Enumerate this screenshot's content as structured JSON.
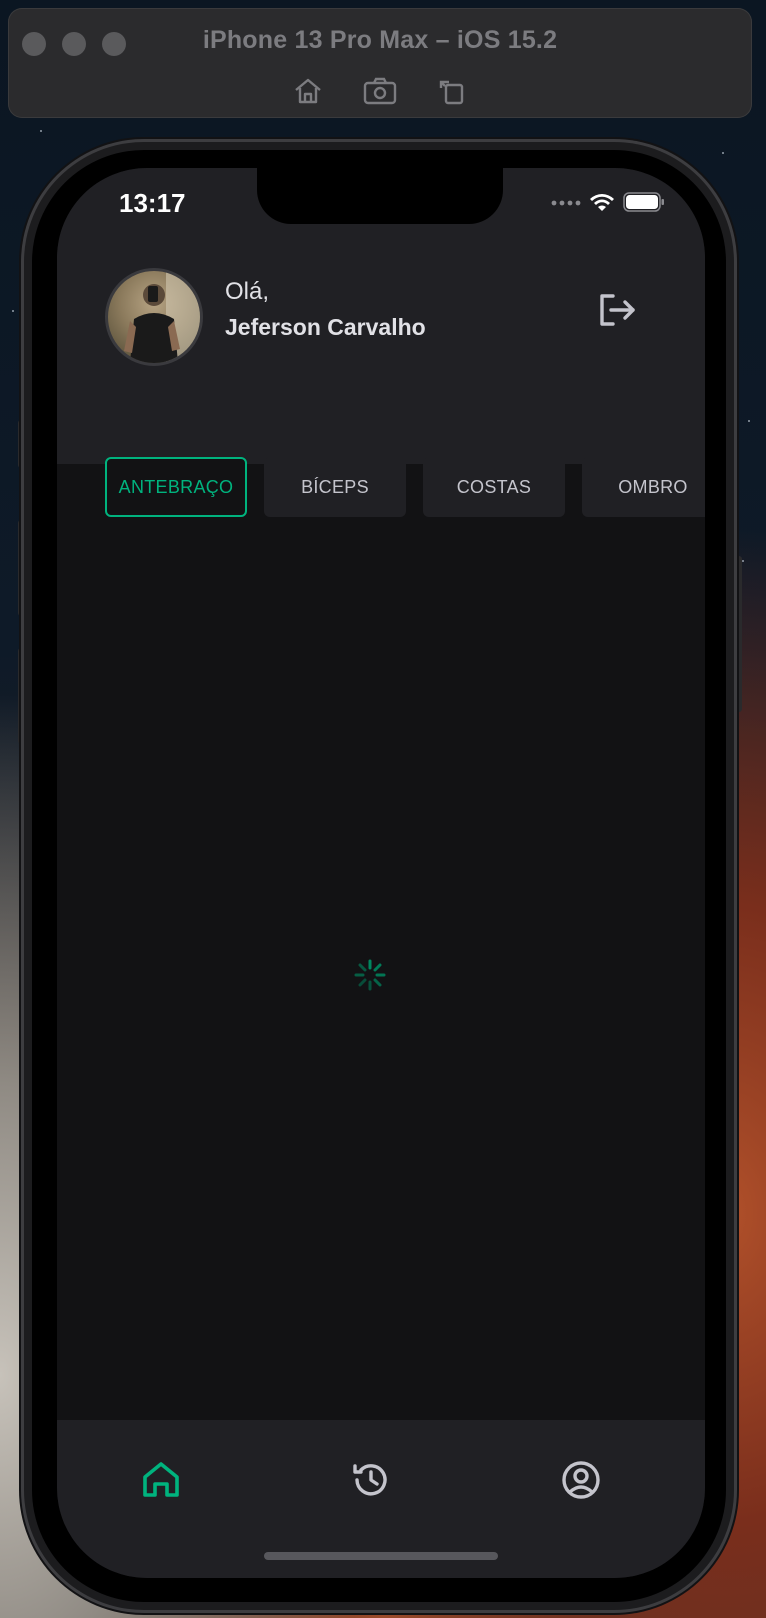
{
  "simulator": {
    "title": "iPhone 13 Pro Max – iOS 15.2",
    "tools": [
      "home-icon",
      "screenshot-icon",
      "rotate-icon"
    ]
  },
  "status_bar": {
    "time": "13:17",
    "icons": [
      "signal-icon",
      "wifi-icon",
      "battery-icon"
    ]
  },
  "header": {
    "greeting": "Olá,",
    "user_name": "Jeferson Carvalho",
    "logout_icon": "logout-icon"
  },
  "groups": {
    "items": [
      {
        "label": "ANTEBRAÇO",
        "active": true
      },
      {
        "label": "BÍCEPS",
        "active": false
      },
      {
        "label": "COSTAS",
        "active": false
      },
      {
        "label": "OMBRO",
        "active": false
      }
    ]
  },
  "loading": {
    "icon": "loading-spinner-icon"
  },
  "tabbar": {
    "items": [
      {
        "icon": "home-icon",
        "active": true
      },
      {
        "icon": "history-icon",
        "active": false
      },
      {
        "icon": "profile-icon",
        "active": false
      }
    ]
  },
  "colors": {
    "accent": "#00b37e",
    "surface": "#202024",
    "background": "#121214",
    "text": "#e1e1e6",
    "muted": "#c4c4cc"
  }
}
